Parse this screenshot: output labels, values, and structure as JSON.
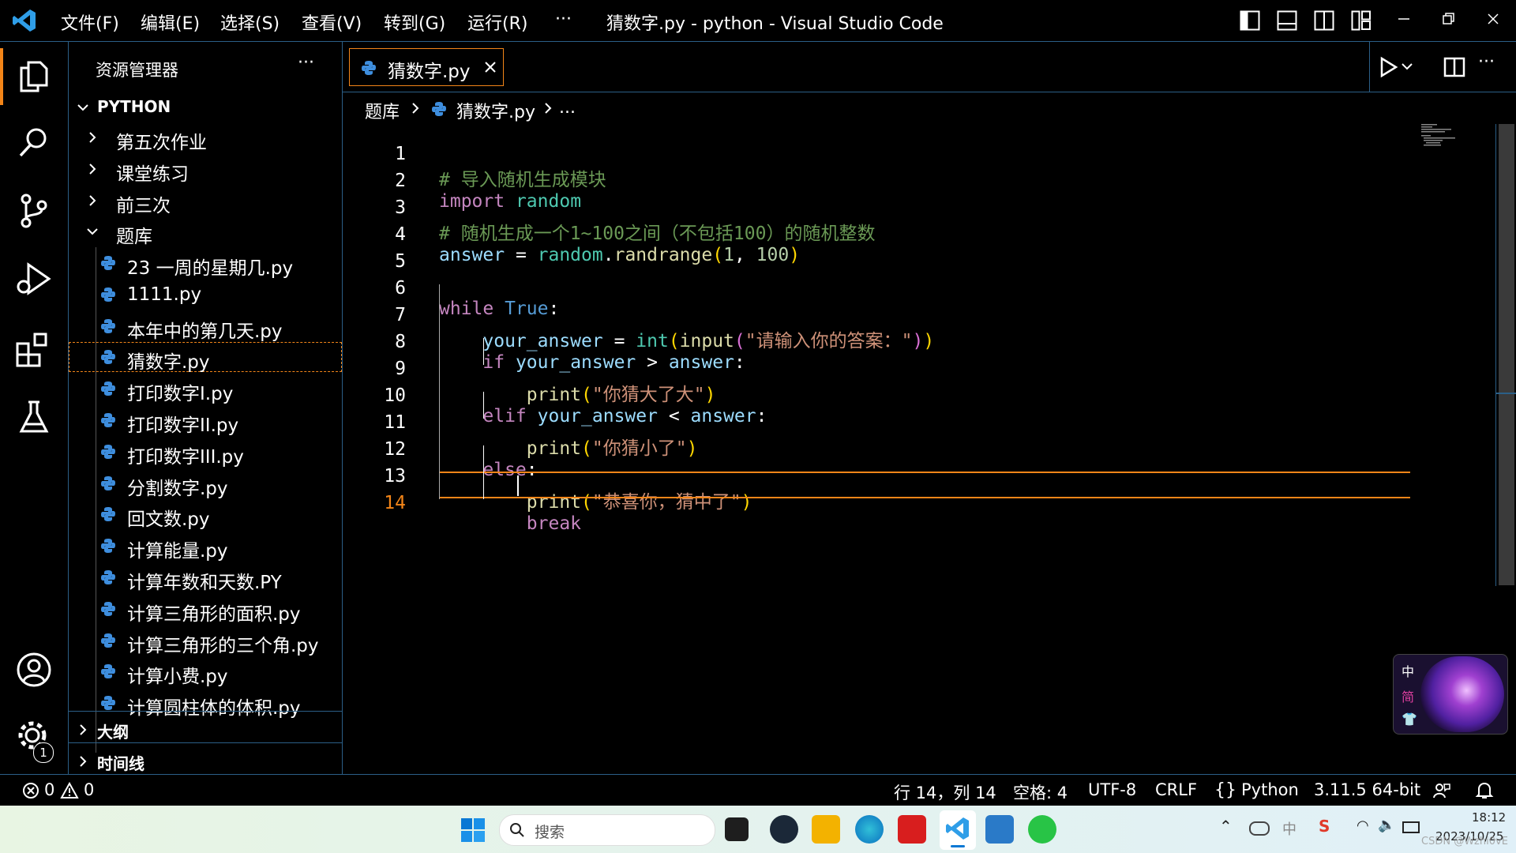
{
  "window": {
    "title": "猜数字.py - python - Visual Studio Code",
    "menu": [
      "文件(F)",
      "编辑(E)",
      "选择(S)",
      "查看(V)",
      "转到(G)",
      "运行(R)",
      "···"
    ]
  },
  "sidebar": {
    "title": "资源管理器",
    "more": "···",
    "root": "PYTHON",
    "folders": [
      "第五次作业",
      "课堂练习",
      "前三次"
    ],
    "open_folder": "题库",
    "files": [
      "23 一周的星期几.py",
      "1111.py",
      "本年中的第几天.py",
      "猜数字.py",
      "打印数字I.py",
      "打印数字II.py",
      "打印数字III.py",
      "分割数字.py",
      "回文数.py",
      "计算能量.py",
      "计算年数和天数.PY",
      "计算三角形的面积.py",
      "计算三角形的三个角.py",
      "计算小费.py",
      "计算圆柱体的体积.py"
    ],
    "outline": "大纲",
    "timeline": "时间线"
  },
  "editor": {
    "tab_label": "猜数字.py",
    "breadcrumb": [
      "题库",
      "猜数字.py",
      "..."
    ],
    "lines": {
      "l1": "# 导入随机生成模块",
      "l3": "# 随机生成一个1~100之间（不包括100）的随机整数",
      "kw_import": "import",
      "mod_random": "random",
      "var_answer": "answer",
      "eq": " = ",
      "fn_randrange": "randrange",
      "n1": "1",
      "n100": "100",
      "kw_while": "while",
      "kw_true": "True",
      "var_your_answer": "your_answer",
      "fn_int": "int",
      "fn_input": "input",
      "s_prompt": "\"请输入你的答案：\"",
      "kw_if": "if",
      "kw_elif": "elif",
      "kw_else": "else",
      "kw_break": "break",
      "fn_print": "print",
      "s_big": "\"你猜大了大\"",
      "s_small": "\"你猜小了\"",
      "s_right": "\"恭喜你，猜中了\""
    }
  },
  "statusbar": {
    "errors": "0",
    "warnings": "0",
    "position": "行 14，列 14",
    "spaces": "空格: 4",
    "encoding": "UTF-8",
    "eol": "CRLF",
    "language": "Python",
    "interpreter": "3.11.5 64-bit",
    "badge": "1"
  },
  "ime": {
    "lang": "中",
    "mode": "简"
  },
  "taskbar": {
    "search_placeholder": "搜索",
    "time": "18:12",
    "date": "2023/10/25",
    "tray_lang": "中",
    "watermark": "CSDN @Wzhi0vE"
  },
  "colors": {
    "accent": "#2b5f87",
    "focus": "#f38518"
  }
}
